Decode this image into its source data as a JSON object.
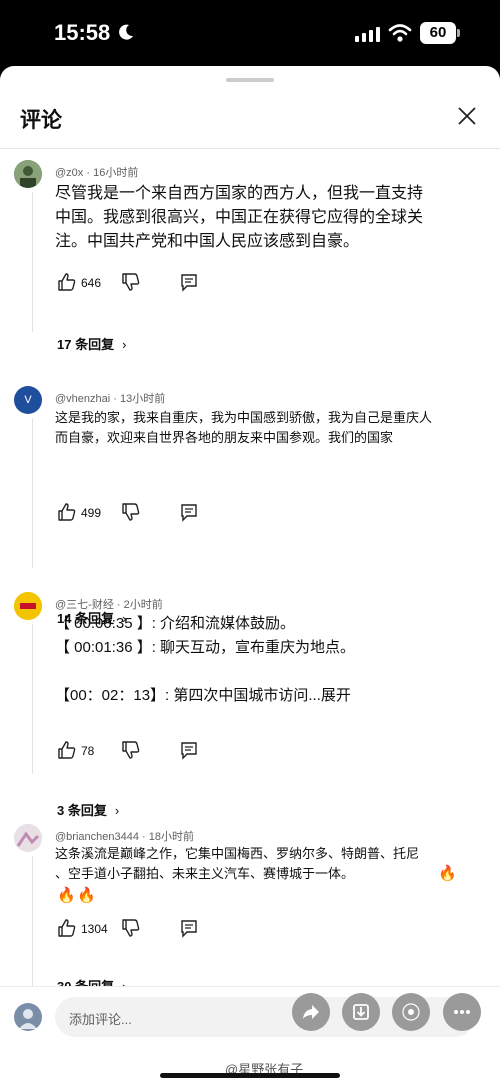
{
  "status_bar": {
    "time": "15:58",
    "battery": "60"
  },
  "sheet": {
    "title": "评论"
  },
  "comments": [
    {
      "author": "@z0x",
      "time": "16小时前",
      "lines": [
        "尽管我是一个来自西方国家的西方人，但我一直支持",
        "中国。我感到很高兴，中国正在获得它应得的全球关",
        "注。中国共产党和中国人民应该感到自豪。"
      ],
      "likes": "646",
      "replies_label": "17 条回复"
    },
    {
      "author": "@vhenzhai",
      "time": "13小时前",
      "avatar_letter": "V",
      "lines": [
        "这是我的家，我来自重庆，我为中国感到骄傲，我为自己是重庆人",
        "而自豪，欢迎来自世界各地的朋友来中国参观。我们的国家"
      ],
      "likes": "499",
      "replies_label": "14 条回复"
    },
    {
      "author": "@三七-财经",
      "time": "2小时前",
      "lines": [
        "【 00:00:35 】: 介绍和流媒体鼓励。",
        "【 00:01:36 】: 聊天互动，宣布重庆为地点。",
        "",
        "【00：02：13】: 第四次中国城市访问...展开"
      ],
      "likes": "78",
      "replies_label": "3 条回复"
    },
    {
      "author": "@brianchen3444",
      "time": "18小时前",
      "lines": [
        "这条溪流是巅峰之作，它集中国梅西、罗纳尔多、特朗普、托尼",
        "、空手道小子翻拍、未来主义汽车、赛博城于一体。"
      ],
      "likes": "1304",
      "replies_label": "30 条回复"
    }
  ],
  "composer": {
    "placeholder": "添加评论..."
  },
  "watermark": "@星野张有子",
  "icons": {
    "moon": "moon-icon",
    "signal": "signal-icon",
    "wifi": "wifi-icon",
    "close": "close-icon",
    "like": "thumb-up-icon",
    "dislike": "thumb-down-icon",
    "reply": "comment-icon",
    "chevron": "chevron-right-icon",
    "fire": "fire-icon",
    "share": "share-icon",
    "download": "download-icon",
    "more": "more-dots-icon"
  }
}
